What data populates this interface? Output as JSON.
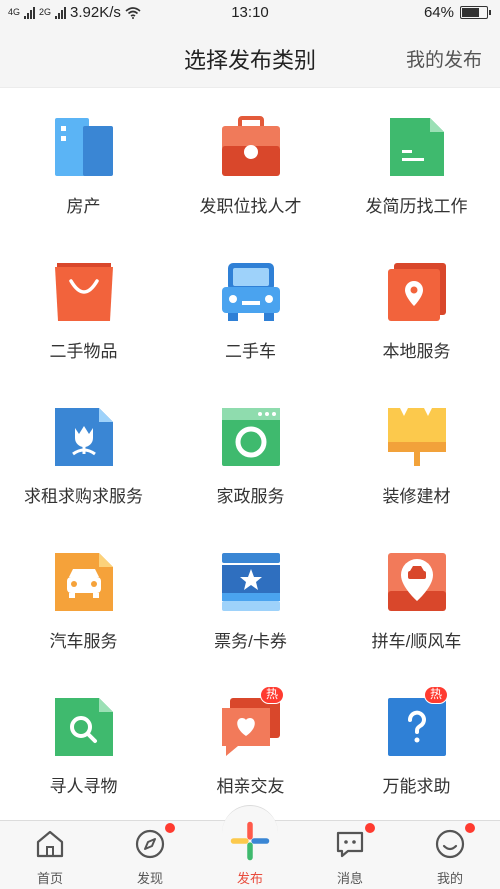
{
  "status_bar": {
    "network_left": "4G",
    "network_right": "2G",
    "speed": "3.92K/s",
    "time": "13:10",
    "battery": "64%",
    "battery_level": 0.64
  },
  "header": {
    "title": "选择发布类别",
    "my_publish": "我的发布"
  },
  "categories": [
    {
      "label": "房产",
      "icon": "building-icon"
    },
    {
      "label": "发职位找人才",
      "icon": "briefcase-icon"
    },
    {
      "label": "发简历找工作",
      "icon": "resume-icon"
    },
    {
      "label": "二手物品",
      "icon": "shopping-bag-icon"
    },
    {
      "label": "二手车",
      "icon": "car-icon"
    },
    {
      "label": "本地服务",
      "icon": "location-pin-icon"
    },
    {
      "label": "求租求购求服务",
      "icon": "tulip-icon"
    },
    {
      "label": "家政服务",
      "icon": "washing-machine-icon"
    },
    {
      "label": "装修建材",
      "icon": "paint-roller-icon"
    },
    {
      "label": "汽车服务",
      "icon": "car-service-icon"
    },
    {
      "label": "票务/卡券",
      "icon": "ticket-icon"
    },
    {
      "label": "拼车/顺风车",
      "icon": "carpool-icon"
    },
    {
      "label": "寻人寻物",
      "icon": "magnifier-icon"
    },
    {
      "label": "相亲交友",
      "icon": "heart-chat-icon",
      "badge": "热"
    },
    {
      "label": "万能求助",
      "icon": "question-icon",
      "badge": "热"
    }
  ],
  "tabs": [
    {
      "label": "首页",
      "icon": "home-icon",
      "dot": false
    },
    {
      "label": "发现",
      "icon": "compass-icon",
      "dot": true
    },
    {
      "label": "发布",
      "icon": "plus-icon",
      "dot": false,
      "active": true
    },
    {
      "label": "消息",
      "icon": "message-icon",
      "dot": true
    },
    {
      "label": "我的",
      "icon": "smiley-icon",
      "dot": true
    }
  ],
  "colors": {
    "accent": "#e84c3d",
    "badge_red": "#ff3b30"
  }
}
